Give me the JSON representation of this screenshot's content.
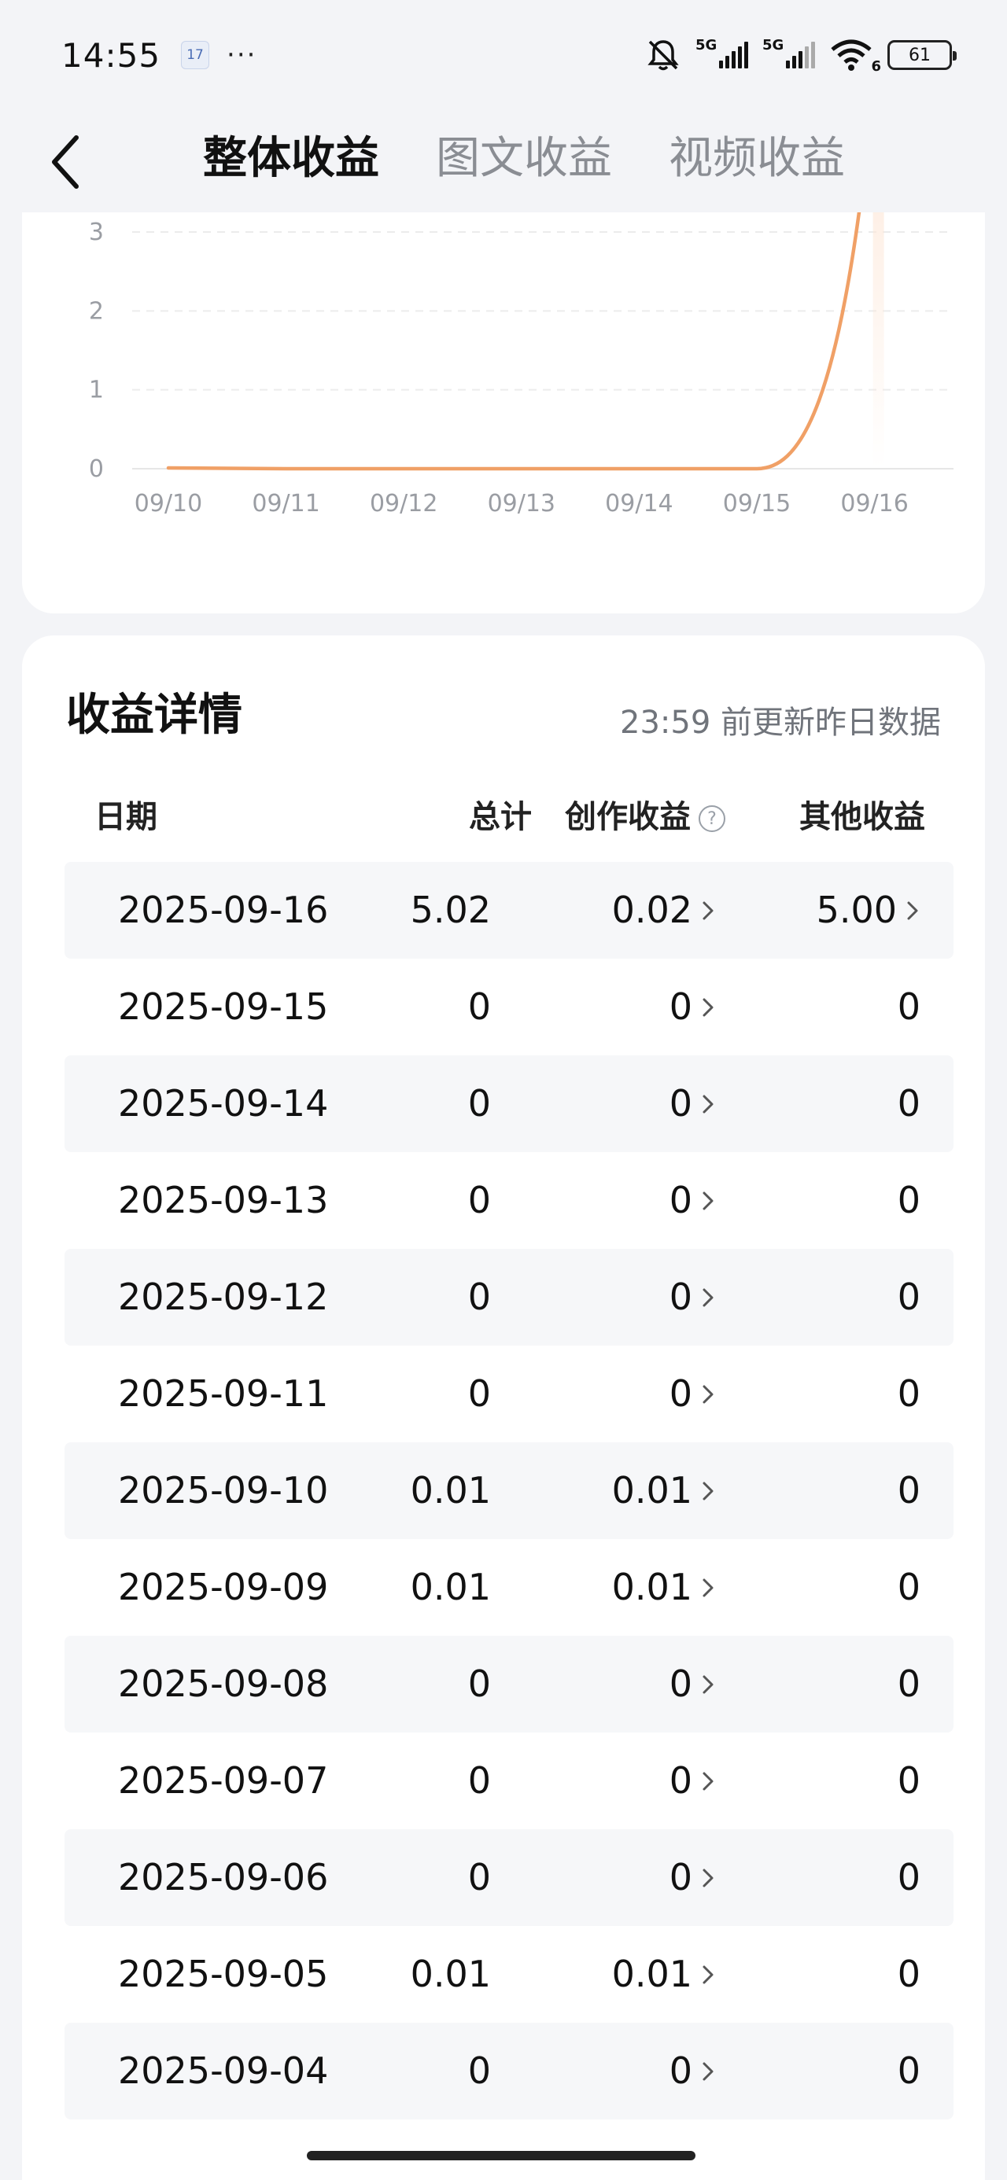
{
  "status_bar": {
    "time": "14:55",
    "calendar_day": "17",
    "more": "···",
    "net1": "5G",
    "net2": "5G",
    "wifi_badge": "6",
    "battery": "61"
  },
  "header": {
    "tabs": [
      {
        "label": "整体收益",
        "active": true
      },
      {
        "label": "图文收益",
        "active": false
      },
      {
        "label": "视频收益",
        "active": false
      }
    ]
  },
  "chart_data": {
    "type": "line",
    "categories": [
      "09/10",
      "09/11",
      "09/12",
      "09/13",
      "09/14",
      "09/15",
      "09/16"
    ],
    "series": [
      {
        "values": [
          0.01,
          0,
          0,
          0,
          0,
          0,
          5.02
        ]
      }
    ],
    "y_ticks": [
      "0",
      "1",
      "2",
      "3"
    ],
    "ylim": [
      0,
      3
    ],
    "grid": true,
    "line_color": "#f0a066"
  },
  "detail": {
    "title": "收益详情",
    "note": "23:59 前更新昨日数据",
    "columns": {
      "date": "日期",
      "total": "总计",
      "create": "创作收益",
      "help": "?",
      "other": "其他收益"
    },
    "rows": [
      {
        "date": "2025-09-16",
        "total": "5.02",
        "create": "0.02",
        "other": "5.00",
        "other_link": true
      },
      {
        "date": "2025-09-15",
        "total": "0",
        "create": "0",
        "other": "0",
        "other_link": false
      },
      {
        "date": "2025-09-14",
        "total": "0",
        "create": "0",
        "other": "0",
        "other_link": false
      },
      {
        "date": "2025-09-13",
        "total": "0",
        "create": "0",
        "other": "0",
        "other_link": false
      },
      {
        "date": "2025-09-12",
        "total": "0",
        "create": "0",
        "other": "0",
        "other_link": false
      },
      {
        "date": "2025-09-11",
        "total": "0",
        "create": "0",
        "other": "0",
        "other_link": false
      },
      {
        "date": "2025-09-10",
        "total": "0.01",
        "create": "0.01",
        "other": "0",
        "other_link": false
      },
      {
        "date": "2025-09-09",
        "total": "0.01",
        "create": "0.01",
        "other": "0",
        "other_link": false
      },
      {
        "date": "2025-09-08",
        "total": "0",
        "create": "0",
        "other": "0",
        "other_link": false
      },
      {
        "date": "2025-09-07",
        "total": "0",
        "create": "0",
        "other": "0",
        "other_link": false
      },
      {
        "date": "2025-09-06",
        "total": "0",
        "create": "0",
        "other": "0",
        "other_link": false
      },
      {
        "date": "2025-09-05",
        "total": "0.01",
        "create": "0.01",
        "other": "0",
        "other_link": false
      },
      {
        "date": "2025-09-04",
        "total": "0",
        "create": "0",
        "other": "0",
        "other_link": false
      }
    ]
  }
}
